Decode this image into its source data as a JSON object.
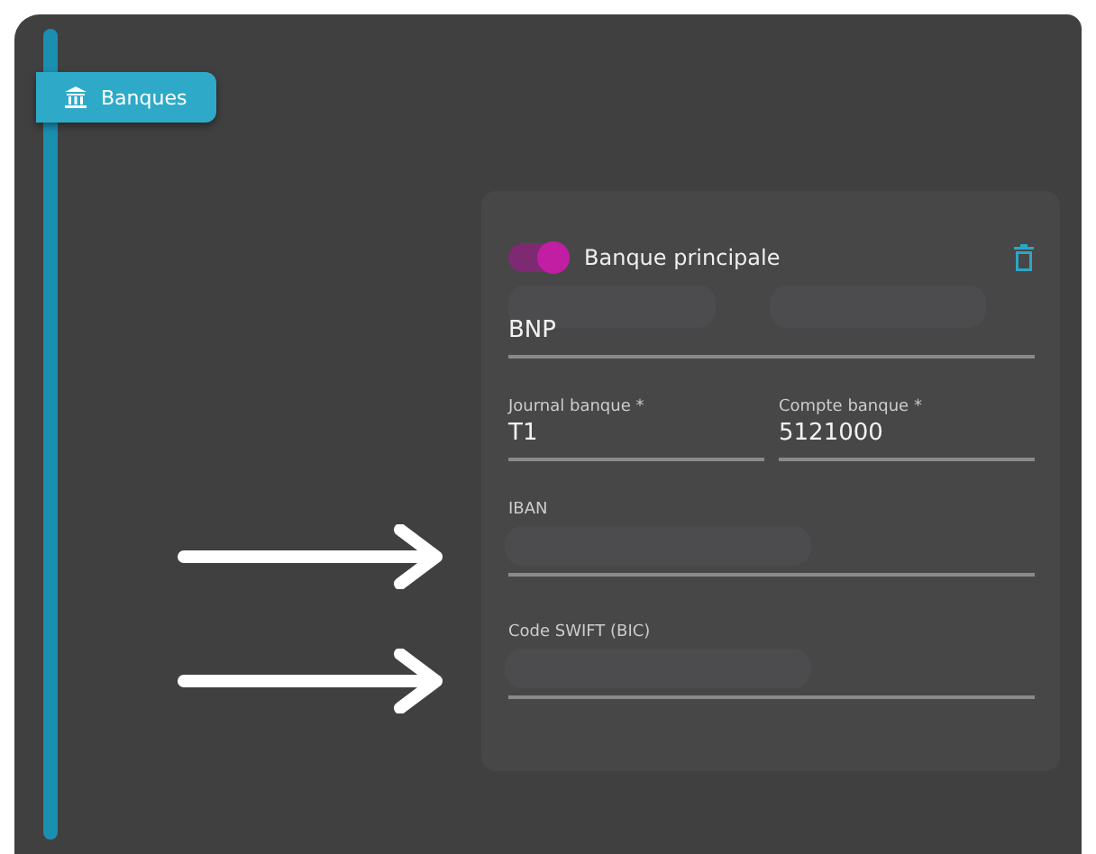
{
  "tab": {
    "label": "Banques"
  },
  "bank_card": {
    "main_bank": {
      "label": "Banque principale",
      "on": true
    },
    "name_field": {
      "value": "BNP"
    },
    "fields": [
      {
        "label": "Journal banque *",
        "value": "T1"
      },
      {
        "label": "Compte banque *",
        "value": "5121000"
      }
    ],
    "empty_fields": [
      {
        "label": "IBAN"
      },
      {
        "label": "Code SWIFT (BIC)"
      }
    ]
  }
}
